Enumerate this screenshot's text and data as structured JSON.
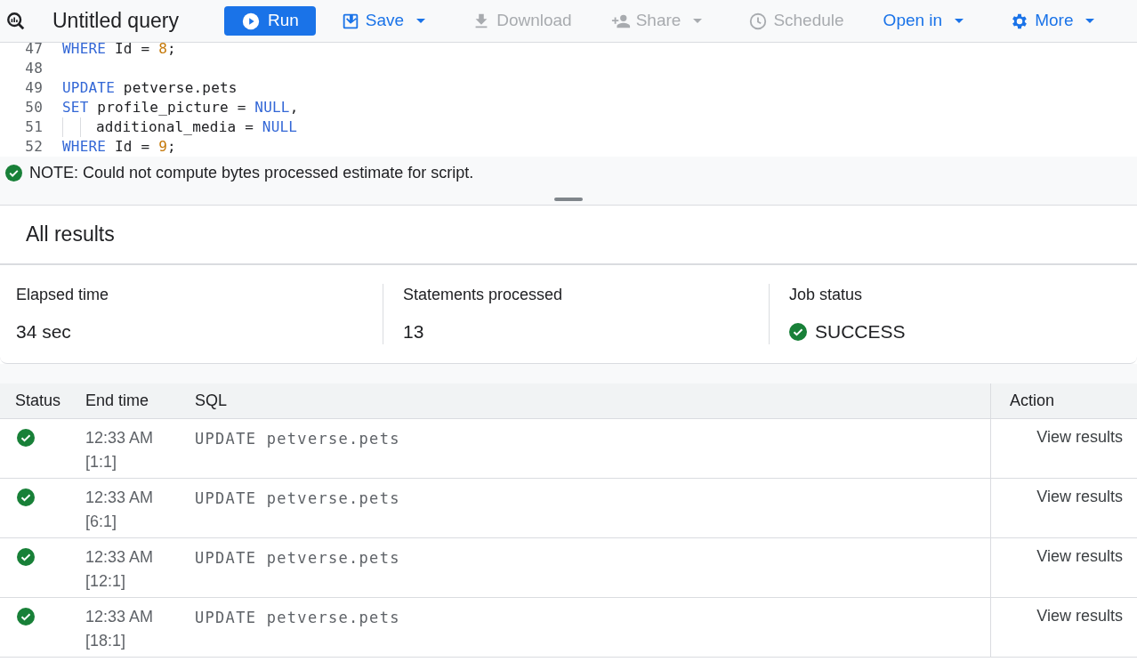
{
  "toolbar": {
    "title": "Untitled query",
    "buttons": [
      {
        "kind": "primary",
        "label": "Run",
        "disabled": false,
        "menu": false
      },
      {
        "kind": "menu",
        "label": "Save",
        "disabled": false,
        "menu": true
      },
      {
        "kind": "menu",
        "label": "Download",
        "disabled": true,
        "menu": false
      },
      {
        "kind": "menu",
        "label": "Share",
        "disabled": true,
        "menu": true
      },
      {
        "kind": "menu",
        "label": "Schedule",
        "disabled": true,
        "menu": false
      },
      {
        "kind": "menu",
        "label": "Open in",
        "disabled": false,
        "menu": true
      },
      {
        "kind": "menu",
        "label": "More",
        "disabled": false,
        "menu": true
      }
    ]
  },
  "editor": {
    "lines": [
      {
        "number": "47",
        "tokens": [
          {
            "kind": "keyword",
            "text": "WHERE"
          },
          {
            "kind": "plain",
            "text": " Id = "
          },
          {
            "kind": "number",
            "text": "8"
          },
          {
            "kind": "plain",
            "text": ";"
          }
        ]
      },
      {
        "number": "48"
      },
      {
        "number": "49",
        "tokens": [
          {
            "kind": "keyword",
            "text": "UPDATE"
          },
          {
            "kind": "plain",
            "text": " petverse.pets"
          }
        ]
      },
      {
        "number": "50",
        "tokens": [
          {
            "kind": "keyword",
            "text": "SET"
          },
          {
            "kind": "plain",
            "text": " profile_picture = "
          },
          {
            "kind": "keyword",
            "text": "NULL"
          },
          {
            "kind": "plain",
            "text": ","
          }
        ]
      },
      {
        "number": "51",
        "indent": true,
        "tokens": [
          {
            "kind": "plain",
            "text": "additional_media = "
          },
          {
            "kind": "keyword",
            "text": "NULL"
          }
        ]
      },
      {
        "number": "52",
        "tokens": [
          {
            "kind": "keyword",
            "text": "WHERE"
          },
          {
            "kind": "plain",
            "text": " Id = "
          },
          {
            "kind": "number",
            "text": "9"
          },
          {
            "kind": "plain",
            "text": ";"
          }
        ]
      }
    ]
  },
  "note": "NOTE: Could not compute bytes processed estimate for script.",
  "results": {
    "title": "All results",
    "summary": [
      {
        "label": "Elapsed time",
        "value": "34 sec",
        "success": false
      },
      {
        "label": "Statements processed",
        "value": "13",
        "success": false
      },
      {
        "label": "Job status",
        "value": "SUCCESS",
        "success": true
      }
    ],
    "table": {
      "columns": [
        "Status",
        "End time",
        "SQL",
        "Action"
      ],
      "rows": [
        {
          "success": true,
          "time": "12:33 AM",
          "position": "[1:1]",
          "sql": "UPDATE petverse.pets",
          "action": "View results"
        },
        {
          "success": true,
          "time": "12:33 AM",
          "position": "[6:1]",
          "sql": "UPDATE petverse.pets",
          "action": "View results"
        },
        {
          "success": true,
          "time": "12:33 AM",
          "position": "[12:1]",
          "sql": "UPDATE petverse.pets",
          "action": "View results"
        },
        {
          "success": true,
          "time": "12:33 AM",
          "position": "[18:1]",
          "sql": "UPDATE petverse.pets",
          "action": "View results"
        }
      ]
    }
  }
}
